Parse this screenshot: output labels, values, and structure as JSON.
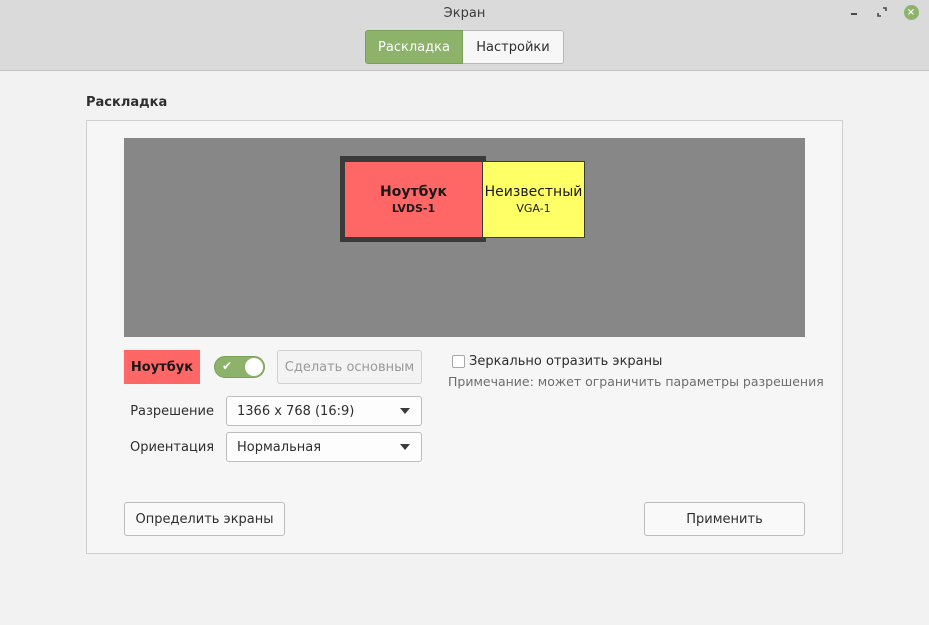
{
  "window": {
    "title": "Экран",
    "close_color": "#8cb369"
  },
  "tabs": [
    {
      "label": "Раскладка",
      "active": true
    },
    {
      "label": "Настройки",
      "active": false
    }
  ],
  "layout": {
    "section_title": "Раскладка",
    "monitors": [
      {
        "name": "Ноутбук",
        "id": "LVDS-1",
        "color": "#ff6666",
        "selected": true
      },
      {
        "name": "Неизвестный",
        "id": "VGA-1",
        "color": "#ffff66",
        "selected": false
      }
    ],
    "selected_display_label": "Ноутбук",
    "enabled_toggle": true,
    "make_primary_label": "Сделать основным",
    "mirror": {
      "label": "Зеркально отразить экраны",
      "checked": false,
      "note": "Примечание: может ограничить параметры разрешения"
    },
    "resolution": {
      "label": "Разрешение",
      "value": "1366 x 768 (16:9)"
    },
    "orientation": {
      "label": "Ориентация",
      "value": "Нормальная"
    },
    "detect_label": "Определить экраны",
    "apply_label": "Применить"
  },
  "icons": {
    "minimize": "minimize-icon",
    "maximize": "maximize-icon",
    "close": "close-icon",
    "toggle_check": "check-icon",
    "dropdown": "chevron-down-icon"
  }
}
